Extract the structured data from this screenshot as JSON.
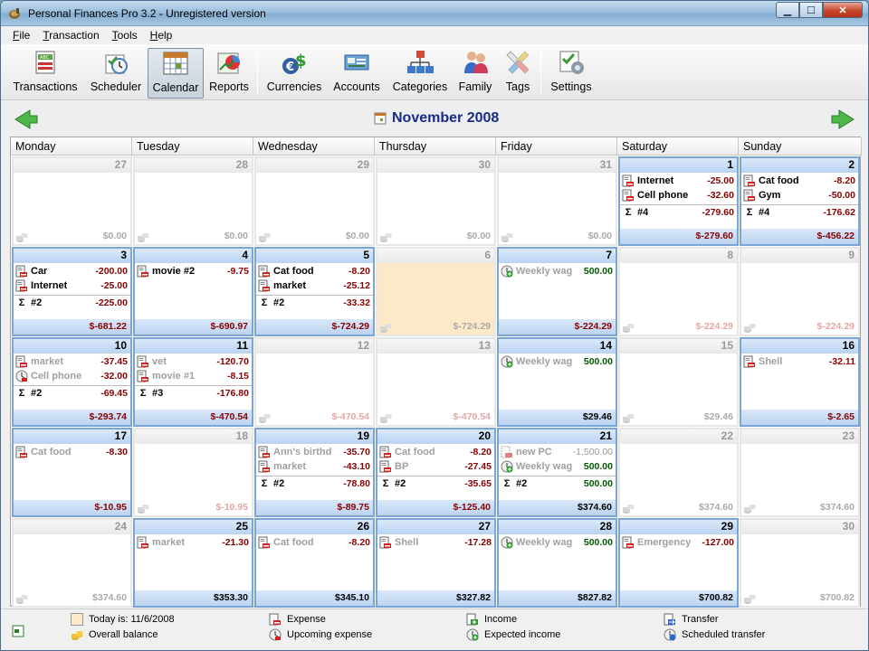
{
  "window": {
    "title": "Personal Finances Pro 3.2 - Unregistered version"
  },
  "menu": [
    {
      "u": "F",
      "rest": "ile"
    },
    {
      "u": "T",
      "rest": "ransaction"
    },
    {
      "u": "T",
      "rest": "ools"
    },
    {
      "u": "H",
      "rest": "elp"
    }
  ],
  "toolbar": [
    "Transactions",
    "Scheduler",
    "Calendar",
    "Reports",
    "Currencies",
    "Accounts",
    "Categories",
    "Family",
    "Tags",
    "Settings"
  ],
  "toolbar_active": "Calendar",
  "calendar": {
    "title": "November 2008",
    "weekdays": [
      "Monday",
      "Tuesday",
      "Wednesday",
      "Thursday",
      "Friday",
      "Saturday",
      "Sunday"
    ],
    "cells": [
      {
        "d": "27",
        "kind": "out",
        "tx": [],
        "bal": "$0.00"
      },
      {
        "d": "28",
        "kind": "out",
        "tx": [],
        "bal": "$0.00"
      },
      {
        "d": "29",
        "kind": "out",
        "tx": [],
        "bal": "$0.00"
      },
      {
        "d": "30",
        "kind": "out",
        "tx": [],
        "bal": "$0.00"
      },
      {
        "d": "31",
        "kind": "out",
        "tx": [],
        "bal": "$0.00"
      },
      {
        "d": "1",
        "kind": "cur",
        "tx": [
          {
            "n": "Internet",
            "a": "-25.00",
            "t": "exp"
          },
          {
            "n": "Cell phone",
            "a": "-32.60",
            "t": "exp"
          }
        ],
        "sum": {
          "n": "#4",
          "a": "-279.60"
        },
        "bal": "$-279.60"
      },
      {
        "d": "2",
        "kind": "cur",
        "tx": [
          {
            "n": "Cat food",
            "a": "-8.20",
            "t": "exp"
          },
          {
            "n": "Gym",
            "a": "-50.00",
            "t": "exp"
          }
        ],
        "sum": {
          "n": "#4",
          "a": "-176.62"
        },
        "bal": "$-456.22"
      },
      {
        "d": "3",
        "kind": "cur",
        "tx": [
          {
            "n": "Car",
            "a": "-200.00",
            "t": "exp"
          },
          {
            "n": "Internet",
            "a": "-25.00",
            "t": "exp"
          }
        ],
        "sum": {
          "n": "#2",
          "a": "-225.00"
        },
        "bal": "$-681.22"
      },
      {
        "d": "4",
        "kind": "cur",
        "tx": [
          {
            "n": "movie #2",
            "a": "-9.75",
            "t": "exp"
          }
        ],
        "bal": "$-690.97"
      },
      {
        "d": "5",
        "kind": "cur",
        "tx": [
          {
            "n": "Cat food",
            "a": "-8.20",
            "t": "exp"
          },
          {
            "n": "market",
            "a": "-25.12",
            "t": "exp"
          }
        ],
        "sum": {
          "n": "#2",
          "a": "-33.32"
        },
        "bal": "$-724.29"
      },
      {
        "d": "6",
        "kind": "today",
        "tx": [],
        "bal": "$-724.29"
      },
      {
        "d": "7",
        "kind": "cur",
        "tx": [
          {
            "n": "Weekly wag",
            "a": "500.00",
            "t": "inc-up"
          }
        ],
        "bal": "$-224.29"
      },
      {
        "d": "8",
        "kind": "out",
        "tx": [],
        "bal": "$-224.29",
        "lt": true
      },
      {
        "d": "9",
        "kind": "out",
        "tx": [],
        "bal": "$-224.29",
        "lt": true
      },
      {
        "d": "10",
        "kind": "cur",
        "tx": [
          {
            "n": "market",
            "a": "-37.45",
            "t": "exp-up"
          },
          {
            "n": "Cell phone",
            "a": "-32.00",
            "t": "upc"
          }
        ],
        "sum": {
          "n": "#2",
          "a": "-69.45"
        },
        "bal": "$-293.74"
      },
      {
        "d": "11",
        "kind": "cur",
        "tx": [
          {
            "n": "vet",
            "a": "-120.70",
            "t": "exp-up"
          },
          {
            "n": "movie #1",
            "a": "-8.15",
            "t": "exp-up"
          }
        ],
        "sum": {
          "n": "#3",
          "a": "-176.80"
        },
        "bal": "$-470.54"
      },
      {
        "d": "12",
        "kind": "out",
        "tx": [],
        "bal": "$-470.54",
        "lt": true
      },
      {
        "d": "13",
        "kind": "out",
        "tx": [],
        "bal": "$-470.54",
        "lt": true
      },
      {
        "d": "14",
        "kind": "cur",
        "tx": [
          {
            "n": "Weekly wag",
            "a": "500.00",
            "t": "inc-up"
          }
        ],
        "bal": "$29.46",
        "pos": true
      },
      {
        "d": "15",
        "kind": "out",
        "tx": [],
        "bal": "$29.46"
      },
      {
        "d": "16",
        "kind": "cur",
        "tx": [
          {
            "n": "Shell",
            "a": "-32.11",
            "t": "exp-up"
          }
        ],
        "bal": "$-2.65"
      },
      {
        "d": "17",
        "kind": "cur",
        "tx": [
          {
            "n": "Cat food",
            "a": "-8.30",
            "t": "exp-up"
          }
        ],
        "bal": "$-10.95"
      },
      {
        "d": "18",
        "kind": "out",
        "tx": [],
        "bal": "$-10.95",
        "lt": true
      },
      {
        "d": "19",
        "kind": "cur",
        "tx": [
          {
            "n": "Ann's birthd",
            "a": "-35.70",
            "t": "exp-up"
          },
          {
            "n": "market",
            "a": "-43.10",
            "t": "exp-up"
          }
        ],
        "sum": {
          "n": "#2",
          "a": "-78.80"
        },
        "bal": "$-89.75"
      },
      {
        "d": "20",
        "kind": "cur",
        "tx": [
          {
            "n": "Cat food",
            "a": "-8.20",
            "t": "exp-up"
          },
          {
            "n": "BP",
            "a": "-27.45",
            "t": "exp-up"
          }
        ],
        "sum": {
          "n": "#2",
          "a": "-35.65"
        },
        "bal": "$-125.40"
      },
      {
        "d": "21",
        "kind": "cur",
        "tx": [
          {
            "n": "new PC",
            "a": "-1,500.00",
            "t": "sched"
          },
          {
            "n": "Weekly wag",
            "a": "500.00",
            "t": "inc-up"
          }
        ],
        "sum": {
          "n": "#2",
          "a": "500.00",
          "inc": true
        },
        "bal": "$374.60",
        "pos": true
      },
      {
        "d": "22",
        "kind": "out",
        "tx": [],
        "bal": "$374.60"
      },
      {
        "d": "23",
        "kind": "out",
        "tx": [],
        "bal": "$374.60"
      },
      {
        "d": "24",
        "kind": "out",
        "tx": [],
        "bal": "$374.60"
      },
      {
        "d": "25",
        "kind": "cur",
        "tx": [
          {
            "n": "market",
            "a": "-21.30",
            "t": "exp-up"
          }
        ],
        "bal": "$353.30",
        "pos": true
      },
      {
        "d": "26",
        "kind": "cur",
        "tx": [
          {
            "n": "Cat food",
            "a": "-8.20",
            "t": "exp-up"
          }
        ],
        "bal": "$345.10",
        "pos": true
      },
      {
        "d": "27",
        "kind": "cur",
        "tx": [
          {
            "n": "Shell",
            "a": "-17.28",
            "t": "exp-up"
          }
        ],
        "bal": "$327.82",
        "pos": true
      },
      {
        "d": "28",
        "kind": "cur",
        "tx": [
          {
            "n": "Weekly wag",
            "a": "500.00",
            "t": "inc-up"
          }
        ],
        "bal": "$827.82",
        "pos": true
      },
      {
        "d": "29",
        "kind": "cur",
        "tx": [
          {
            "n": "Emergency",
            "a": "-127.00",
            "t": "exp-up"
          }
        ],
        "bal": "$700.82",
        "pos": true
      },
      {
        "d": "30",
        "kind": "out",
        "tx": [],
        "bal": "$700.82"
      }
    ]
  },
  "legend": {
    "today": "Today is: 11/6/2008",
    "balance": "Overall balance",
    "expense": "Expense",
    "upcoming_expense": "Upcoming expense",
    "income": "Income",
    "expected_income": "Expected income",
    "transfer": "Transfer",
    "scheduled_transfer": "Scheduled transfer"
  },
  "colors": {
    "accent": "#7ba5d6",
    "today": "#fde8c8",
    "negative": "#8b0000",
    "positive": "#005a00",
    "title": "#1a2a8a"
  }
}
